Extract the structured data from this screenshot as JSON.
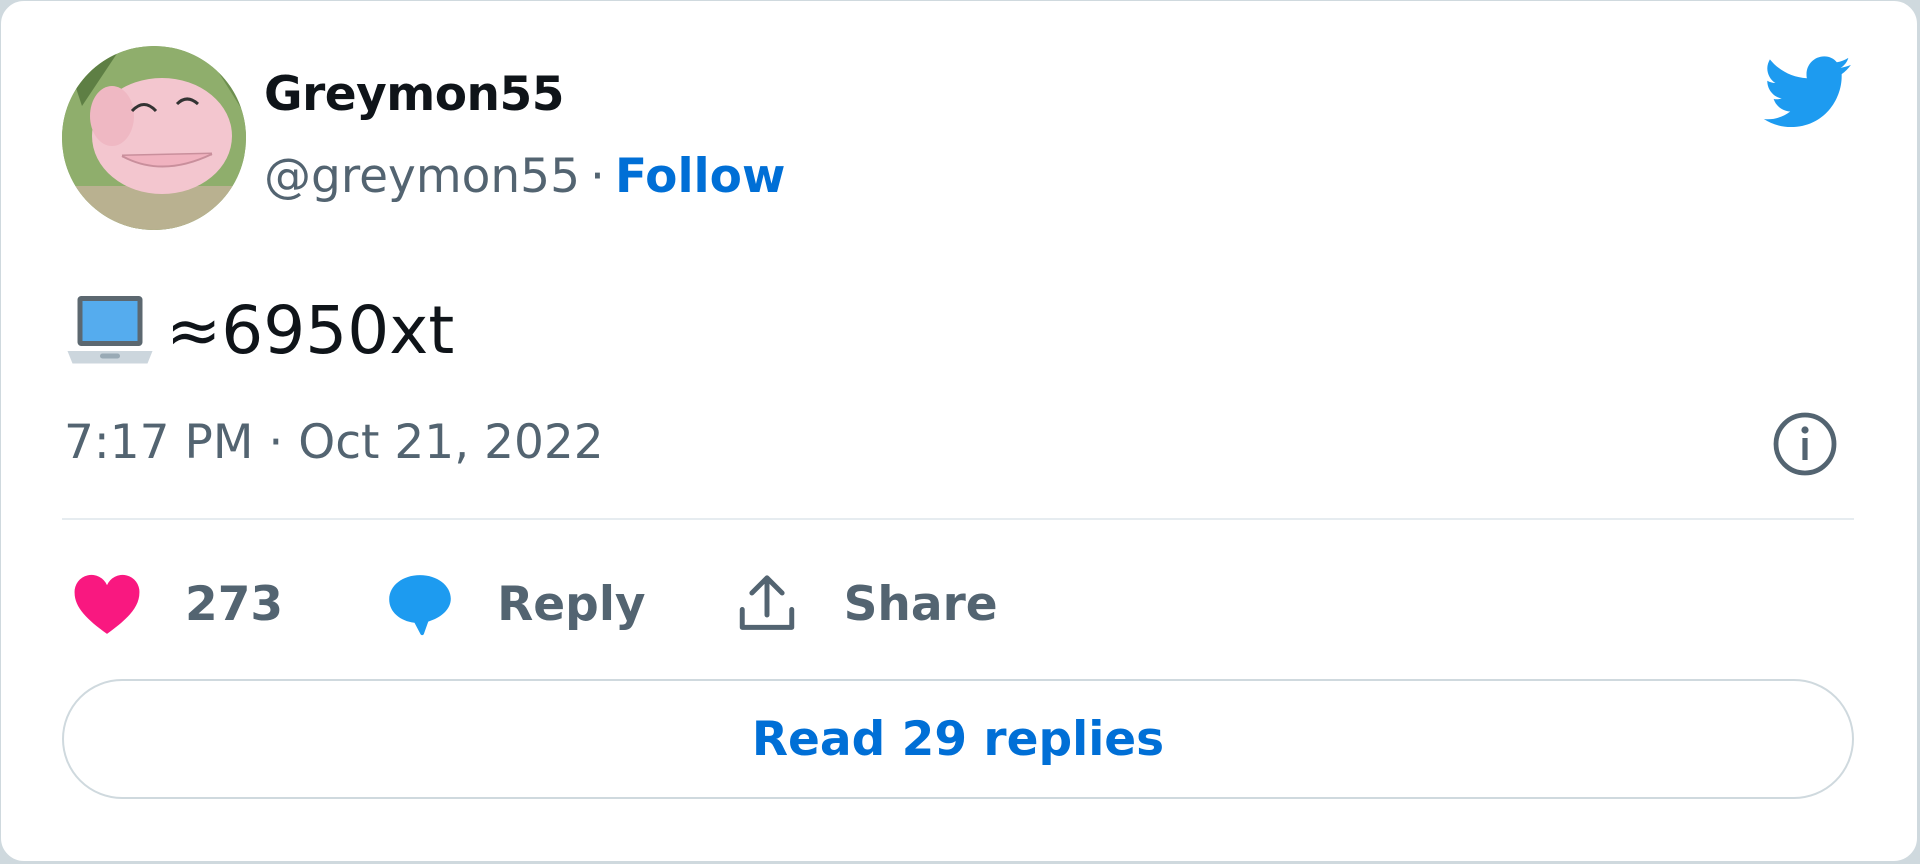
{
  "author": {
    "display_name": "Greymon55",
    "handle": "@greymon55",
    "separator": "·",
    "follow_label": "Follow",
    "avatar": "profile-avatar"
  },
  "tweet": {
    "emoji_icon": "laptop-emoji-icon",
    "text": "≈6950xt",
    "timestamp": "7:17 PM · Oct 21, 2022"
  },
  "actions": {
    "like_count": "273",
    "reply_label": "Reply",
    "share_label": "Share"
  },
  "read_replies_label": "Read 29 replies",
  "colors": {
    "brand_blue": "#1d9bf0",
    "link_blue": "#006fd6",
    "like_pink": "#f91880",
    "secondary_text": "#536471",
    "primary_text": "#0f1419"
  }
}
